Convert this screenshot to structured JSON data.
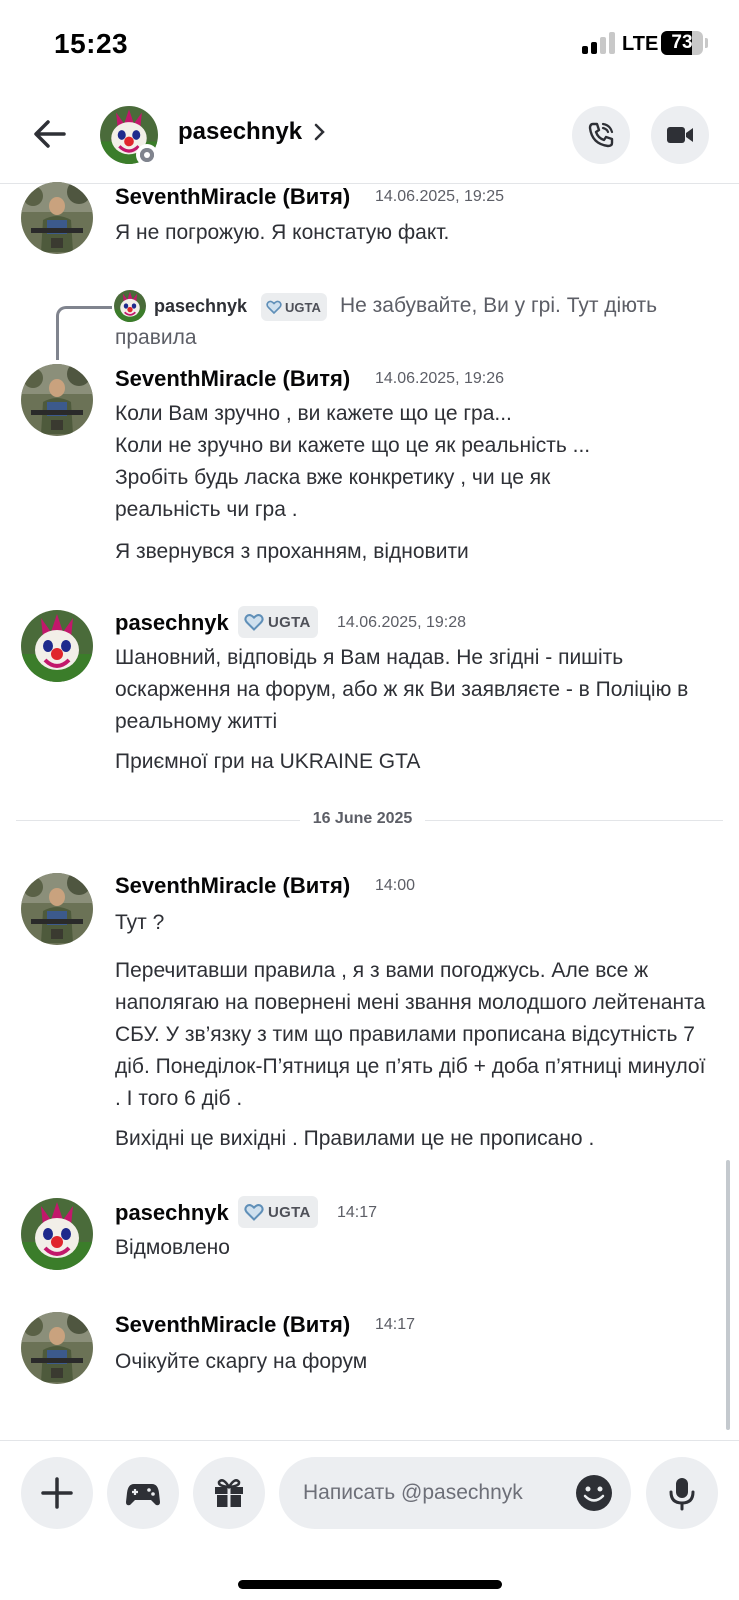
{
  "status_bar": {
    "time": "15:23",
    "network": "LTE",
    "battery": "73",
    "battery_level": 0.73
  },
  "header": {
    "contact_name": "pasechnyk",
    "back_icon": "arrow-left-icon",
    "call_icon": "phone-call-icon",
    "video_icon": "video-camera-icon"
  },
  "messages": [
    {
      "author": "SeventhMiracle (Витя)",
      "timestamp": "14.06.2025, 19:25",
      "lines": [
        "Я не погрожую. Я констатую факт."
      ]
    },
    {
      "reply": {
        "author": "pasechnyk",
        "badge": "UGTA",
        "text": "Не забувайте, Ви у грі. Тут діють правила"
      },
      "author": "SeventhMiracle (Витя)",
      "timestamp": "14.06.2025, 19:26",
      "lines": [
        "Коли Вам зручно , ви кажете що це гра...",
        "Коли не зручно ви кажете що це як реальність ...",
        "Зробіть будь ласка вже конкретику , чи це як реальність чи гра ."
      ],
      "followup": "Я звернувся з проханням, відновити"
    },
    {
      "author": "pasechnyk",
      "badge": "UGTA",
      "timestamp": "14.06.2025, 19:28",
      "lines": [
        "Шановний, відповідь я Вам надав. Не згідні - пишіть оскарження на форум, або ж як Ви заявляєте - в Поліцію в реальному житті"
      ],
      "followup": "Приємної гри на UKRAINE GTA"
    },
    {
      "date_divider": "16 June 2025"
    },
    {
      "author": "SeventhMiracle (Витя)",
      "timestamp": "14:00",
      "lines": [
        "Тут ?"
      ],
      "followup": "Перечитавши правила , я з вами погоджусь. Але все ж наполягаю на повернені мені звання молодшого лейтенанта СБУ. У зв’язку з тим що правилами прописана відсутність 7 діб. Понеділок-П’ятниця це п’ять діб + доба п’ятниці минулої . І того 6 діб .",
      "followup2": "Вихідні це вихідні . Правилами це не прописано ."
    },
    {
      "author": "pasechnyk",
      "badge": "UGTA",
      "timestamp": "14:17",
      "lines": [
        "Відмовлено"
      ]
    },
    {
      "author": "SeventhMiracle (Витя)",
      "timestamp": "14:17",
      "lines": [
        "Очікуйте скаргу на форум"
      ]
    }
  ],
  "composer": {
    "placeholder": "Написать @pasechnyk",
    "buttons": [
      "plus-icon",
      "gamepad-icon",
      "gift-icon",
      "emoji-icon",
      "microphone-icon"
    ]
  },
  "colors": {
    "badge_heart": "#5f8fb8",
    "text": "#2e3036",
    "muted": "#5c5e66"
  }
}
